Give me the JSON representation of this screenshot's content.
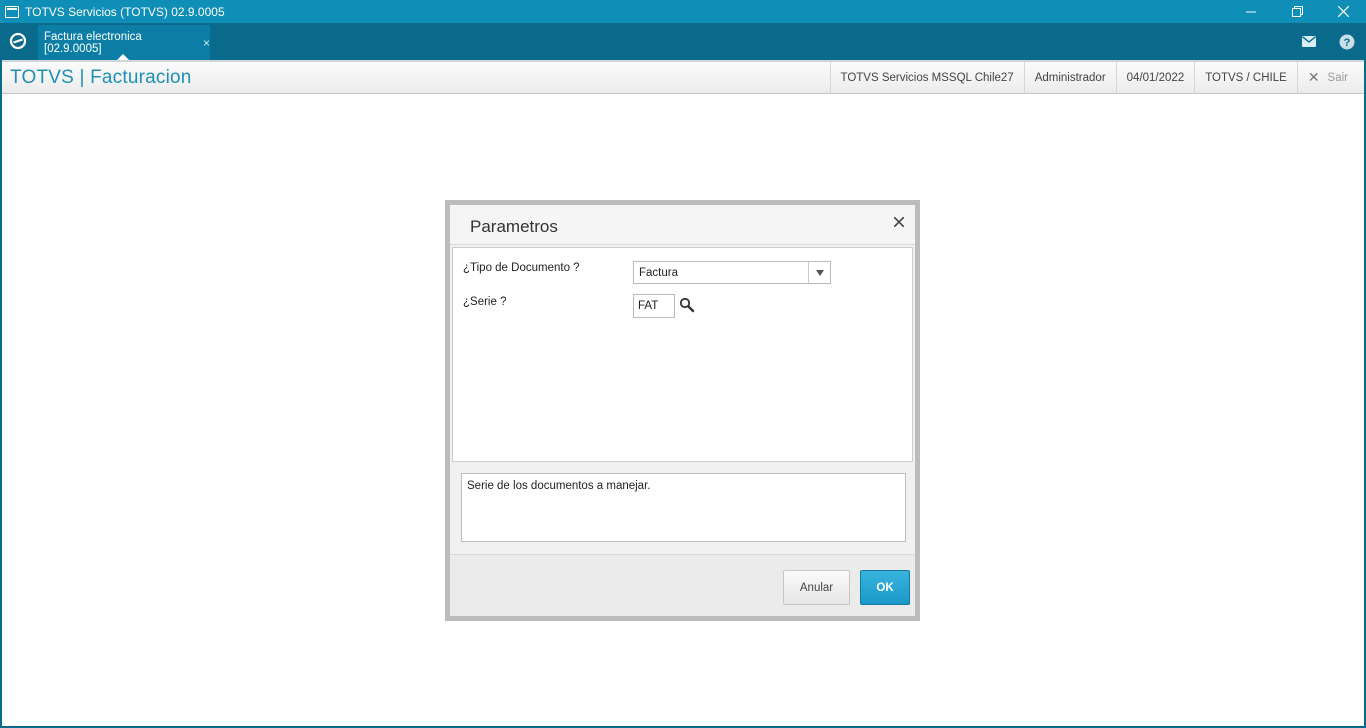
{
  "window": {
    "title": "TOTVS Servicios (TOTVS) 02.9.0005",
    "minimize_icon": "minimize-icon",
    "restore_icon": "restore-icon",
    "close_icon": "close-icon"
  },
  "tabbar": {
    "home_icon": "totvs-logo-icon",
    "active_tab": {
      "label": "Factura electronica [02.9.0005]",
      "close_glyph": "×"
    },
    "mail_icon": "mail-icon",
    "help_icon": "help-icon"
  },
  "header": {
    "brand": "TOTVS | Facturacion",
    "environment": "TOTVS Servicios MSSQL Chile27",
    "user": "Administrador",
    "date": "04/01/2022",
    "company": "TOTVS / CHILE",
    "exit_label": "Sair"
  },
  "dialog": {
    "title": "Parametros",
    "fields": {
      "tipo_documento": {
        "label": "¿Tipo de Documento ?",
        "value": "Factura"
      },
      "serie": {
        "label": "¿Serie ?",
        "value": "FAT"
      }
    },
    "help_text": "Serie de los documentos a manejar.",
    "buttons": {
      "cancel": "Anular",
      "ok": "OK"
    }
  },
  "colors": {
    "title_bar": "#0f8fb8",
    "tab_bar": "#0a6a8c",
    "brand_text": "#1e8fb6",
    "ok_button": "#1c98c8"
  }
}
